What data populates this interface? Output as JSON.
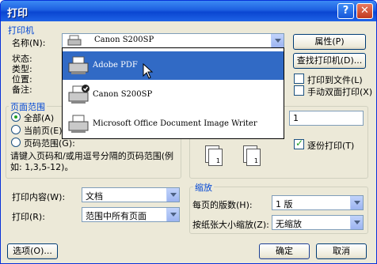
{
  "window": {
    "title": "打印",
    "help_symbol": "?",
    "close_symbol": "✕"
  },
  "printer": {
    "group_title": "打印机",
    "name_label": "名称(N):",
    "selected": "Canon S200SP",
    "status_label": "状态:",
    "type_label": "类型:",
    "location_label": "位置:",
    "comment_label": "备注:",
    "properties_button": "属性(P)",
    "find_printer_button": "查找打印机(D)...",
    "print_to_file_label": "打印到文件(L)",
    "manual_duplex_label": "手动双面打印(X)",
    "dropdown_items": [
      {
        "label": "Adobe PDF",
        "icon": "pdf-printer-icon"
      },
      {
        "label": "Canon S200SP",
        "icon": "default-printer-icon"
      },
      {
        "label": "Microsoft Office Document Image Writer",
        "icon": "printer-icon"
      }
    ]
  },
  "page_range": {
    "group_title": "页面范围",
    "all_label": "全部(A)",
    "current_label": "当前页(E)",
    "pages_label": "页码范围(G):",
    "hint": "请键入页码和/或用逗号分隔的页码范围(例如: 1,3,5-12)。"
  },
  "copies": {
    "count_value": "1",
    "collate_label": "逐份打印(T)",
    "page_labels": [
      "1",
      "1",
      "3",
      "2"
    ]
  },
  "print_what": {
    "label": "打印内容(W):",
    "value": "文档"
  },
  "print_scope": {
    "label": "打印(R):",
    "value": "范围中所有页面"
  },
  "zoom": {
    "group_title": "缩放",
    "pages_per_sheet_label": "每页的版数(H):",
    "pages_per_sheet_value": "1 版",
    "scale_label": "按纸张大小缩放(Z):",
    "scale_value": "无缩放"
  },
  "footer": {
    "options_button": "选项(O)...",
    "ok_button": "确定",
    "cancel_button": "取消"
  },
  "colors": {
    "title_blue": "#0a46d1",
    "selection": "#316ac5",
    "group_title": "#0046d5"
  }
}
